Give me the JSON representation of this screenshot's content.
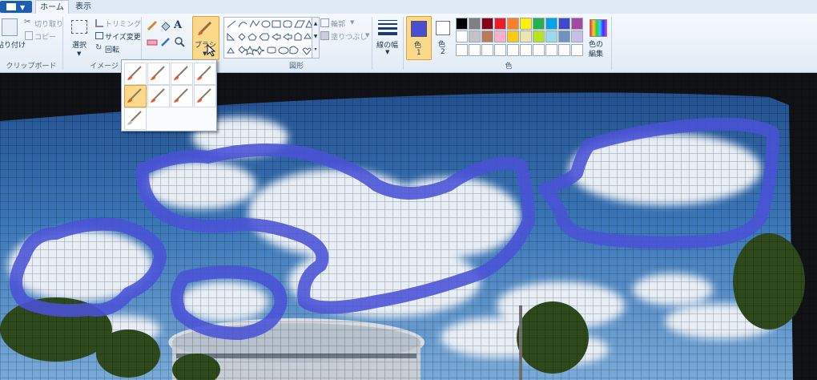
{
  "tabs": {
    "home": "ホーム",
    "view": "表示"
  },
  "clipboard": {
    "paste": "貼り付け",
    "cut": "切り取り",
    "copy": "コピー",
    "group": "クリップボード"
  },
  "image": {
    "select": "選択",
    "crop": "トリミング",
    "resize": "サイズ変更",
    "rotate": "回転",
    "group": "イメージ"
  },
  "brushes": {
    "label": "ブラシ"
  },
  "shapes": {
    "outline": "輪郭",
    "fill": "塗りつぶし",
    "group": "図形"
  },
  "size": {
    "label": "線の幅"
  },
  "colors": {
    "color1": "色",
    "color1_num": "1",
    "color2": "色",
    "color2_num": "2",
    "edit": "色の",
    "edit2": "編集",
    "group": "色",
    "color1_value": "#4a4fcf",
    "color2_value": "#ffffff",
    "palette": [
      "#000000",
      "#7f7f7f",
      "#880015",
      "#ed1c24",
      "#ff7f27",
      "#fff200",
      "#22b14c",
      "#00a2e8",
      "#3f48cc",
      "#a349a4",
      "#ffffff",
      "#c3c3c3",
      "#b97a57",
      "#ffaec9",
      "#ffc90e",
      "#efe4b0",
      "#b5e61d",
      "#99d9ea",
      "#7092be",
      "#c8bfe7"
    ]
  },
  "icons": [
    "menu-icon",
    "paste-icon",
    "cut-icon",
    "copy-icon",
    "select-icon",
    "crop-icon",
    "resize-icon",
    "rotate-icon",
    "pencil-icon",
    "fill-icon",
    "text-icon",
    "eraser-icon",
    "picker-icon",
    "magnifier-icon",
    "brush-icon",
    "cursor-icon",
    "size-icon",
    "rainbow-icon"
  ],
  "canvas": {
    "stroke_color": "#4a52d6"
  }
}
